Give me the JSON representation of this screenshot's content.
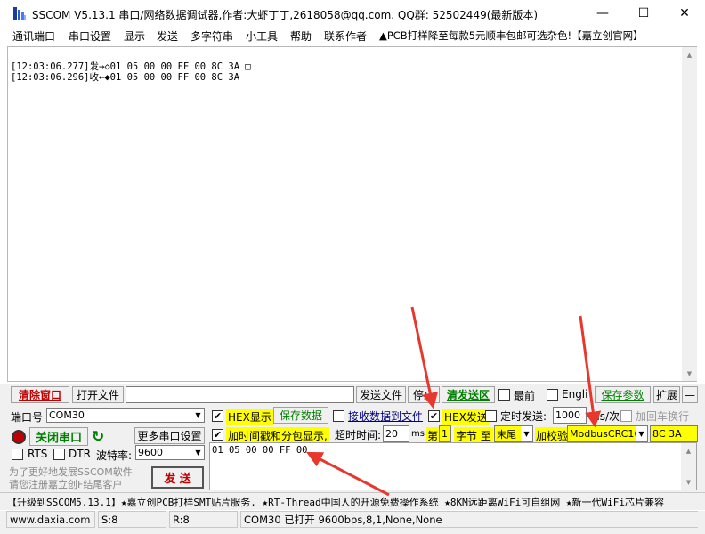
{
  "window": {
    "title": "SSCOM V5.13.1 串口/网络数据调试器,作者:大虾丁丁,2618058@qq.com. QQ群:  52502449(最新版本)",
    "minimize": "—",
    "maximize": "☐",
    "close": "✕"
  },
  "menu": [
    "通讯端口",
    "串口设置",
    "显示",
    "发送",
    "多字符串",
    "小工具",
    "帮助",
    "联系作者",
    "▲PCB打样降至每款5元顺丰包邮可选杂色!【嘉立创官网】"
  ],
  "receive": {
    "lines": [
      "[12:03:06.277]发→◇01 05 00 00 FF 00 8C 3A □",
      "[12:03:06.296]收←◆01 05 00 00 FF 00 8C 3A"
    ]
  },
  "toolbar": {
    "clear_window": "清除窗口",
    "open_file": "打开文件",
    "send_file": "发送文件",
    "stop": "停止",
    "clear_send": "清发送区",
    "topmost": "最前",
    "english": "English",
    "save_params": "保存参数",
    "expand": "扩展",
    "collapse": "—"
  },
  "port": {
    "port_label": "端口号",
    "port_value": "COM30",
    "close_port": "关闭串口",
    "more_settings": "更多串口设置",
    "rts": "RTS",
    "dtr": "DTR",
    "baud_label": "波特率:",
    "baud_value": "9600",
    "promo1": "为了更好地发展SSCOM软件",
    "promo2": "请您注册嘉立创F结尾客户",
    "send_button": "发  送"
  },
  "options": {
    "hex_display": "HEX显示",
    "save_data": "保存数据",
    "recv_to_file": "接收数据到文件",
    "hex_send": "HEX发送",
    "timed_send": "定时发送:",
    "interval": "1000",
    "interval_unit": "ms/次",
    "add_crlf": "加回车换行",
    "timestamp": "加时间戳和分包显示,",
    "timeout_label": "超时时间:",
    "timeout_value": "20",
    "timeout_unit": "ms",
    "nth": "第",
    "byte_index": "1",
    "byte_label": "字节 至",
    "end_value": "末尾",
    "checksum_label": "加校验",
    "checksum_value": "ModbusCRC16",
    "crc_result": "8C 3A",
    "hex_display_checked": "✔",
    "timestamp_checked": "✔",
    "hex_send_checked": "✔"
  },
  "send_area": {
    "content": "01 05 00 00 FF 00"
  },
  "ticker": "【升级到SSCOM5.13.1】★嘉立创PCB打样SMT贴片服务. ★RT-Thread中国人的开源免费操作系统 ★8KM远距离WiFi可自组网 ★新一代WiFi芯片兼容",
  "status": {
    "website": "www.daxia.com",
    "sent": "S:8",
    "received": "R:8",
    "port_status": "COM30 已打开  9600bps,8,1,None,None"
  },
  "colors": {
    "arrow": "#e8382d",
    "highlight": "#ffff00",
    "green_label": "#008000",
    "red_label": "#c00000"
  }
}
